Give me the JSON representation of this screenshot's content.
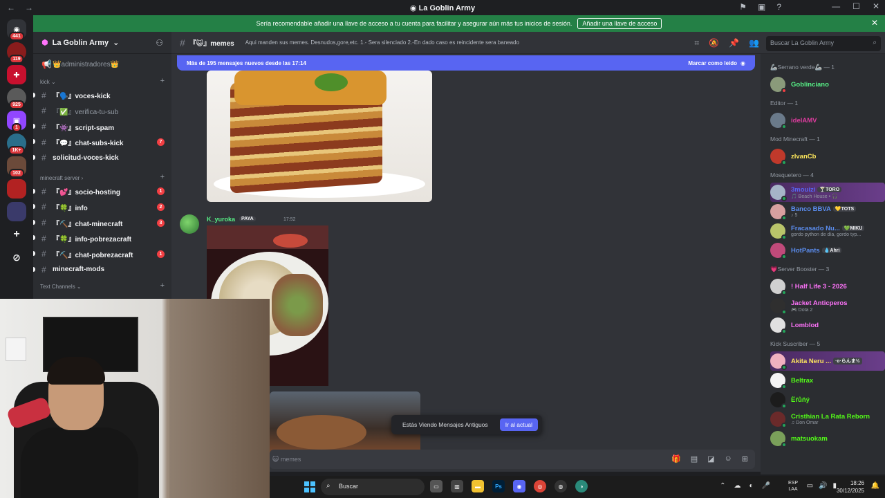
{
  "window": {
    "title": "La Goblin Army"
  },
  "banner": {
    "text": "Sería recomendable añadir una llave de acceso a tu cuenta para facilitar y asegurar aún más tus inicios de sesión.",
    "button": "Añadir una llave de acceso"
  },
  "server": {
    "name": "La Goblin Army"
  },
  "rail_badges": [
    "441",
    "119",
    "925",
    "1",
    "1K+",
    "102"
  ],
  "channels": {
    "top": "👑administradores👑",
    "categories": [
      {
        "name": "kick",
        "items": [
          {
            "name": "『🗣️』voces-kick",
            "unread": true,
            "muted": false,
            "badge": ""
          },
          {
            "name": "『✅』verifica-tu-sub",
            "unread": false,
            "muted": true,
            "badge": ""
          },
          {
            "name": "『👾』script-spam",
            "unread": true,
            "muted": false,
            "badge": ""
          },
          {
            "name": "『💬』chat-subs-kick",
            "unread": true,
            "muted": false,
            "badge": "7"
          },
          {
            "name": "solicitud-voces-kick",
            "unread": true,
            "muted": false,
            "badge": ""
          }
        ]
      },
      {
        "name": "minecraft server",
        "items": [
          {
            "name": "『💕』socio-hosting",
            "unread": true,
            "muted": false,
            "badge": "1"
          },
          {
            "name": "『🍀』info",
            "unread": true,
            "muted": false,
            "badge": "2"
          },
          {
            "name": "『⛏️』chat-minecraft",
            "unread": true,
            "muted": false,
            "badge": "3"
          },
          {
            "name": "『🍀』info-pobrezacraft",
            "unread": true,
            "muted": false,
            "badge": ""
          },
          {
            "name": "『⛏️』chat-pobrezacraft",
            "unread": true,
            "muted": false,
            "badge": "1"
          },
          {
            "name": "minecraft-mods",
            "unread": true,
            "muted": false,
            "badge": ""
          }
        ]
      },
      {
        "name": "Text Channels",
        "items": []
      }
    ]
  },
  "chat_header": {
    "channel": "『😺』memes",
    "topic": "Aqui manden sus memes. Desnudos,gore,etc. 1.- Sera silenciado 2.-En dado caso es reincidente sera baneado",
    "search_placeholder": "Buscar La Goblin Army"
  },
  "new_messages": {
    "text": "Más de 195 mensajes nuevos desde las 17:14",
    "mark_read": "Marcar como leído"
  },
  "message": {
    "author": "K_yuroka",
    "tag": "PAYA",
    "time": "17:52"
  },
  "jump_bar": {
    "text": "Estás Viendo Mensajes Antiguos",
    "button": "Ir al actual"
  },
  "composer": {
    "placeholder": "😺 memes"
  },
  "members": [
    {
      "role": "🦾Serrano verde🦾 — 1",
      "users": [
        {
          "name": "Goblinciano",
          "sub": "",
          "tag": "",
          "color": "#57f287",
          "av": "#8a9a7a",
          "status": "#f23f43",
          "highlight": false
        }
      ]
    },
    {
      "role": "Editor — 1",
      "users": [
        {
          "name": "idelAMV",
          "sub": "",
          "tag": "",
          "color": "#e03ca0",
          "av": "#6a7a8a",
          "status": "#23a55a",
          "highlight": false
        }
      ]
    },
    {
      "role": "Mod Minecraft — 1",
      "users": [
        {
          "name": "zIvanCb",
          "sub": "",
          "tag": "",
          "color": "#fee75c",
          "av": "#c0392b",
          "status": "#23a55a",
          "highlight": false
        }
      ]
    },
    {
      "role": "Mosquetero — 4",
      "users": [
        {
          "name": "3mouizi",
          "sub": "🎵 Beach House • 🎧",
          "tag": "🍸TORO",
          "color": "#5865f2",
          "av": "#a6b4c8",
          "status": "#23a55a",
          "highlight": true
        },
        {
          "name": "Banco BBVA",
          "sub": "♪ 5",
          "tag": "💛TOTS",
          "color": "#5b8def",
          "av": "#d8a0a0",
          "status": "#23a55a",
          "highlight": false
        },
        {
          "name": "Fracasado Nu...",
          "sub": "gordo python de día, gordo typ...",
          "tag": "💚MIKU",
          "color": "#5b8def",
          "av": "#b9c46a",
          "status": "#23a55a",
          "highlight": false
        },
        {
          "name": "HotPants",
          "sub": "",
          "tag": "💧Ahri",
          "color": "#5b8def",
          "av": "#c04a7a",
          "status": "#23a55a",
          "highlight": false
        }
      ]
    },
    {
      "role": "💗Server Booster — 3",
      "users": [
        {
          "name": "! Half Life 3 - 2026",
          "sub": "",
          "tag": "",
          "color": "#ff73fa",
          "av": "#d0d0d0",
          "status": "#23a55a",
          "highlight": false
        },
        {
          "name": "Jacket Anticperos",
          "sub": "🎮 Dota 2",
          "tag": "",
          "color": "#ff73fa",
          "av": "#2f2f2f",
          "status": "#23a55a",
          "highlight": false
        },
        {
          "name": "Lomblod",
          "sub": "",
          "tag": "",
          "color": "#ff73fa",
          "av": "#e0e0e0",
          "status": "#23a55a",
          "highlight": false
        }
      ]
    },
    {
      "role": "Kick Suscriber — 5",
      "users": [
        {
          "name": "Akita Neru ...",
          "sub": "",
          "tag": "·ʚ·らんま½",
          "color": "#fee75c",
          "av": "#f0b0c0",
          "status": "#23a55a",
          "highlight": true
        },
        {
          "name": "Beltrax",
          "sub": "",
          "tag": "",
          "color": "#53fc18",
          "av": "#f4f4f4",
          "status": "#23a55a",
          "highlight": false
        },
        {
          "name": "Ёŕůňý",
          "sub": "",
          "tag": "",
          "color": "#53fc18",
          "av": "#1c1c1c",
          "status": "#23a55a",
          "highlight": false
        },
        {
          "name": "Cristhian La Rata Reborn",
          "sub": "♫ Don Omar",
          "tag": "",
          "color": "#53fc18",
          "av": "#6a2a2a",
          "status": "#23a55a",
          "highlight": false
        },
        {
          "name": "matsuokam",
          "sub": "",
          "tag": "",
          "color": "#53fc18",
          "av": "#7aa05a",
          "status": "#23a55a",
          "highlight": false
        }
      ]
    }
  ],
  "taskbar": {
    "search": "Buscar",
    "lang_top": "ESP",
    "lang_bottom": "LAA",
    "time": "18:26",
    "date": "30/12/2025"
  },
  "icons": {
    "back": "←",
    "forward": "→",
    "hash": "#",
    "search": "⌕",
    "close": "✕",
    "mic": "🎤",
    "inbox": "✉",
    "help": "?",
    "pin": "📌"
  }
}
